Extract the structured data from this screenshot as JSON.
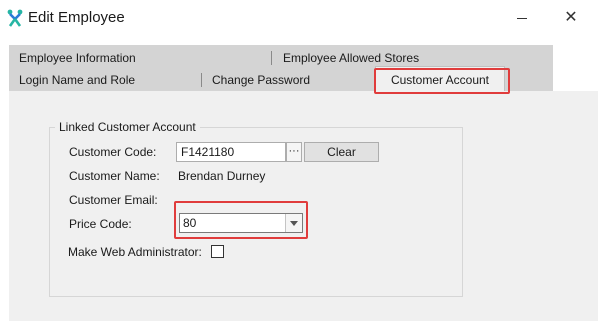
{
  "window": {
    "title": "Edit Employee",
    "icons": {
      "app": "app-logo-icon",
      "minimize": "minimize-icon",
      "close": "close-icon"
    },
    "close_glyph": "✕"
  },
  "tabs": {
    "row1": [
      "Employee Information",
      "Employee Allowed Stores"
    ],
    "row2": [
      "Login Name and Role",
      "Change Password",
      "Customer Account"
    ],
    "active": "Customer Account"
  },
  "linked_account": {
    "group_title": "Linked Customer Account",
    "customer_code": {
      "label": "Customer Code:",
      "value": "F1421180",
      "browse_label": "···",
      "clear_label": "Clear"
    },
    "customer_name": {
      "label": "Customer Name:",
      "value": "Brendan Durney"
    },
    "customer_email": {
      "label": "Customer Email:",
      "value": ""
    },
    "price_code": {
      "label": "Price Code:",
      "value": "80"
    },
    "web_admin": {
      "label": "Make Web Administrator:",
      "checked": false
    }
  },
  "colors": {
    "highlight": "#e03c3c",
    "tab_strip": "#d4d4d4",
    "pane": "#f0f0f0"
  }
}
